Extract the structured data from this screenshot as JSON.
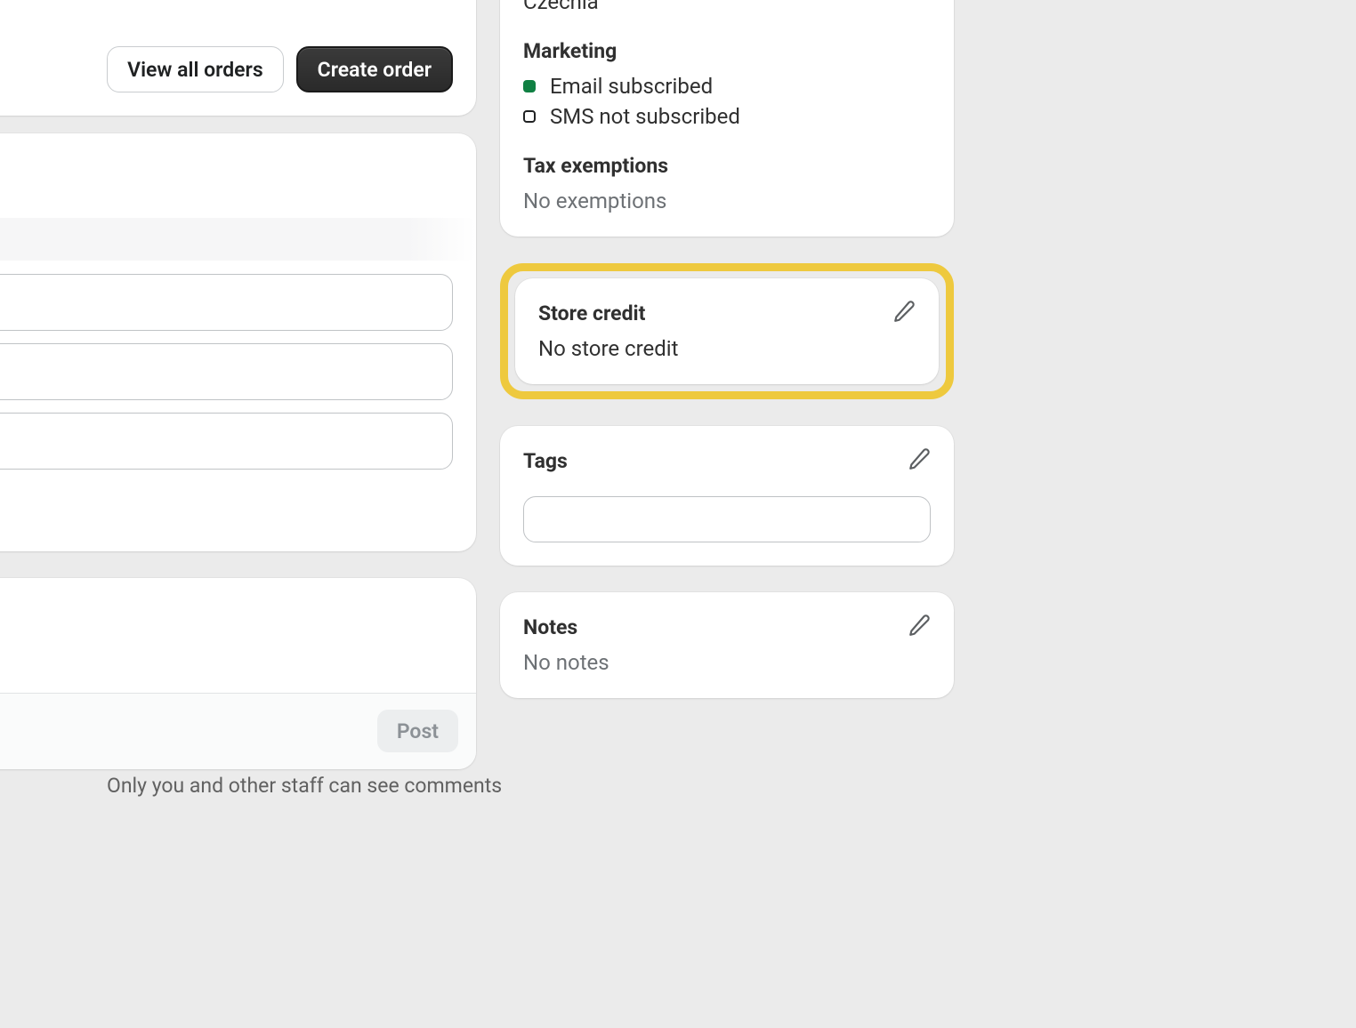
{
  "orders": {
    "view_all_label": "View all orders",
    "create_label": "Create order"
  },
  "timeline": {
    "post_label": "Post",
    "visibility_note": "Only you and other staff can see comments"
  },
  "customer_info": {
    "country": "Czechia",
    "marketing": {
      "heading": "Marketing",
      "email_label": "Email subscribed",
      "sms_label": "SMS not subscribed"
    },
    "tax": {
      "heading": "Tax exemptions",
      "value": "No exemptions"
    }
  },
  "store_credit": {
    "heading": "Store credit",
    "value": "No store credit"
  },
  "tags": {
    "heading": "Tags",
    "placeholder": ""
  },
  "notes": {
    "heading": "Notes",
    "value": "No notes"
  }
}
